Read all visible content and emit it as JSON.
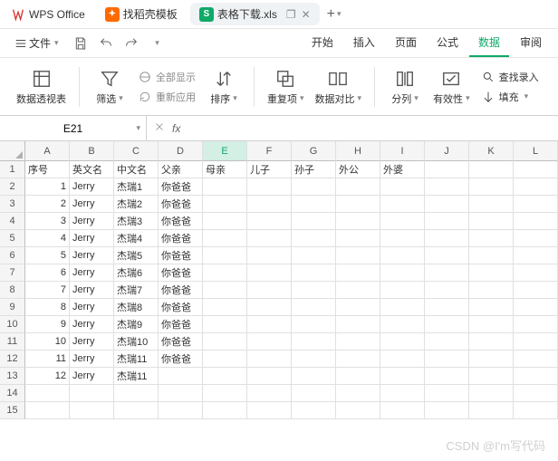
{
  "app": {
    "name": "WPS Office"
  },
  "tabs": [
    {
      "label": "找稻壳模板",
      "icon": "orange",
      "iconText": "✦"
    },
    {
      "label": "表格下载.xls",
      "icon": "green",
      "iconText": "S",
      "active": true
    }
  ],
  "windowControls": {
    "restore": "❐",
    "close": "✕",
    "add": "+"
  },
  "menu": {
    "file": "文件",
    "tabs": [
      "开始",
      "插入",
      "页面",
      "公式",
      "数据",
      "审阅"
    ],
    "activeIndex": 4
  },
  "ribbon": {
    "pivot": "数据透视表",
    "filter": "筛选",
    "showAll": "全部显示",
    "reapply": "重新应用",
    "sort": "排序",
    "duplicates": "重复项",
    "compare": "数据对比",
    "splitCol": "分列",
    "validity": "有效性",
    "fill": "填充",
    "findRecord": "查找录入"
  },
  "formula": {
    "nameBox": "E21",
    "fx": "fx"
  },
  "grid": {
    "cols": [
      "A",
      "B",
      "C",
      "D",
      "E",
      "F",
      "G",
      "H",
      "I",
      "J",
      "K",
      "L"
    ],
    "selectedCol": "E",
    "rowCount": 15,
    "headerRow": [
      "序号",
      "英文名",
      "中文名",
      "父亲",
      "母亲",
      "儿子",
      "孙子",
      "外公",
      "外婆"
    ],
    "rows": [
      [
        "1",
        "Jerry",
        "杰瑞1",
        "你爸爸",
        "",
        "",
        "",
        "",
        ""
      ],
      [
        "2",
        "Jerry",
        "杰瑞2",
        "你爸爸",
        "",
        "",
        "",
        "",
        ""
      ],
      [
        "3",
        "Jerry",
        "杰瑞3",
        "你爸爸",
        "",
        "",
        "",
        "",
        ""
      ],
      [
        "4",
        "Jerry",
        "杰瑞4",
        "你爸爸",
        "",
        "",
        "",
        "",
        ""
      ],
      [
        "5",
        "Jerry",
        "杰瑞5",
        "你爸爸",
        "",
        "",
        "",
        "",
        ""
      ],
      [
        "6",
        "Jerry",
        "杰瑞6",
        "你爸爸",
        "",
        "",
        "",
        "",
        ""
      ],
      [
        "7",
        "Jerry",
        "杰瑞7",
        "你爸爸",
        "",
        "",
        "",
        "",
        ""
      ],
      [
        "8",
        "Jerry",
        "杰瑞8",
        "你爸爸",
        "",
        "",
        "",
        "",
        ""
      ],
      [
        "9",
        "Jerry",
        "杰瑞9",
        "你爸爸",
        "",
        "",
        "",
        "",
        ""
      ],
      [
        "10",
        "Jerry",
        "杰瑞10",
        "你爸爸",
        "",
        "",
        "",
        "",
        ""
      ],
      [
        "11",
        "Jerry",
        "杰瑞11",
        "你爸爸",
        "",
        "",
        "",
        "",
        ""
      ],
      [
        "12",
        "Jerry",
        "杰瑞11",
        "",
        "",
        "",
        "",
        "",
        ""
      ]
    ]
  },
  "watermark": "CSDN @I'm写代码"
}
